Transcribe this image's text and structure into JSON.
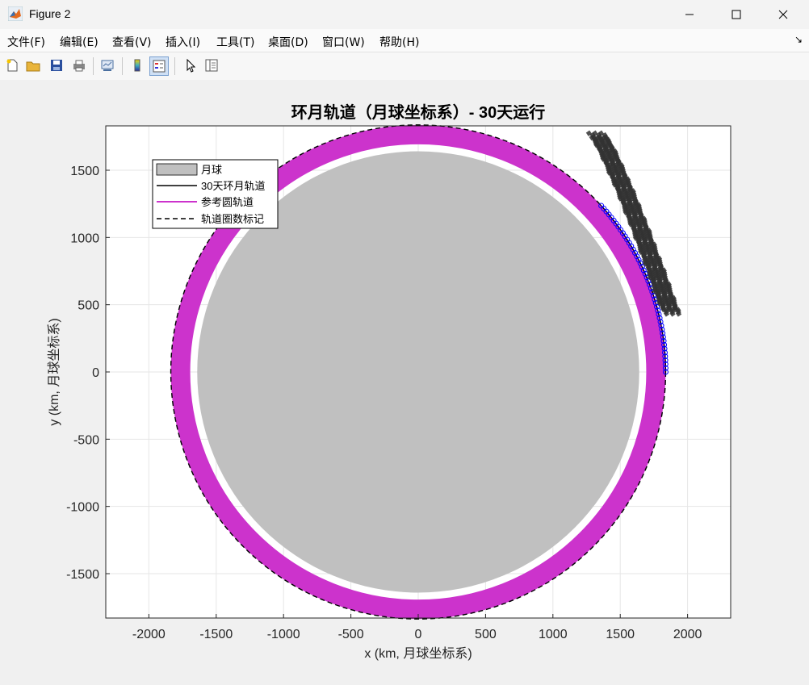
{
  "window": {
    "title": "Figure 2"
  },
  "menu": {
    "items": [
      "文件(F)",
      "编辑(E)",
      "查看(V)",
      "插入(I)",
      "工具(T)",
      "桌面(D)",
      "窗口(W)",
      "帮助(H)"
    ]
  },
  "toolbar": {
    "tools": [
      "new-figure",
      "open-file",
      "save",
      "print",
      "link-plot",
      "insert-colorbar",
      "insert-legend",
      "edit-plot",
      "property-inspector"
    ]
  },
  "plot": {
    "title": "环月轨道（月球坐标系）- 30天运行",
    "xlabel": "x (km, 月球坐标系)",
    "ylabel": "y (km, 月球坐标系)",
    "legend": [
      "月球",
      "30天环月轨道",
      "参考圆轨道",
      "轨道圈数标记"
    ]
  },
  "chart_data": {
    "type": "line",
    "xlim": [
      -2320,
      2320
    ],
    "ylim": [
      -1830,
      1830
    ],
    "xticks": [
      -2000,
      -1500,
      -1000,
      -500,
      0,
      500,
      1000,
      1500,
      2000
    ],
    "yticks": [
      -1500,
      -1000,
      -500,
      0,
      500,
      1000,
      1500
    ],
    "grid": true,
    "legend_position": "top-left",
    "moon": {
      "radius": 1737,
      "color": "#c0c0c0"
    },
    "reference_orbit": {
      "radius": 1837,
      "color": "#cc33cc"
    },
    "orbit_marker_circle": {
      "radius": 1837,
      "style": "dashed",
      "color": "#000000"
    },
    "orbit_30day": {
      "color": "#000000",
      "marker_color": "#0000ff",
      "angle_start_deg": 0,
      "angle_end_deg": 43,
      "radius": 1837
    },
    "labels_region": {
      "x_range": [
        1220,
        1950
      ],
      "y_range": [
        470,
        1780
      ]
    }
  }
}
